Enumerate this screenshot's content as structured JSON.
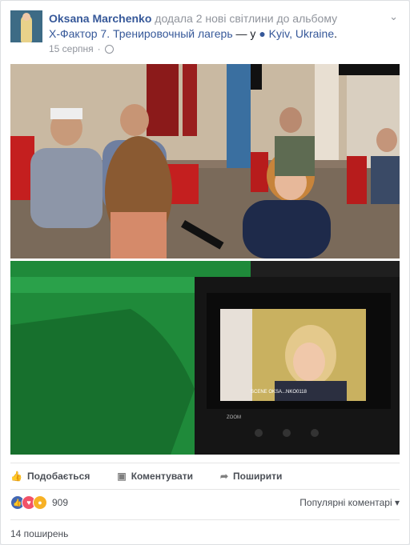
{
  "post": {
    "author": "Oksana Marchenko",
    "action_text": " додала 2 нові світлини до альбому",
    "album_title": "X-Фактор 7. Тренировочный лагерь",
    "location_prefix": " — у ",
    "location": "Kyiv, Ukraine",
    "location_suffix": ".",
    "date": "15 серпня",
    "separator": "·"
  },
  "photos": [
    {
      "kind": "interview"
    },
    {
      "kind": "camera-screen",
      "screen_text": "SCENE OKSA...NKO0118",
      "zoom": "ZOOM"
    }
  ],
  "actions": {
    "like": "Подобається",
    "comment": "Коментувати",
    "share": "Поширити"
  },
  "reactions": {
    "count": "909",
    "types": [
      "like-icon",
      "love-icon",
      "wow-icon"
    ],
    "colors": {
      "like": "#4267b2",
      "love": "#f25268",
      "wow": "#f7b125"
    }
  },
  "popular_comments": "Популярні коментарі",
  "shares_text": "14 поширень"
}
